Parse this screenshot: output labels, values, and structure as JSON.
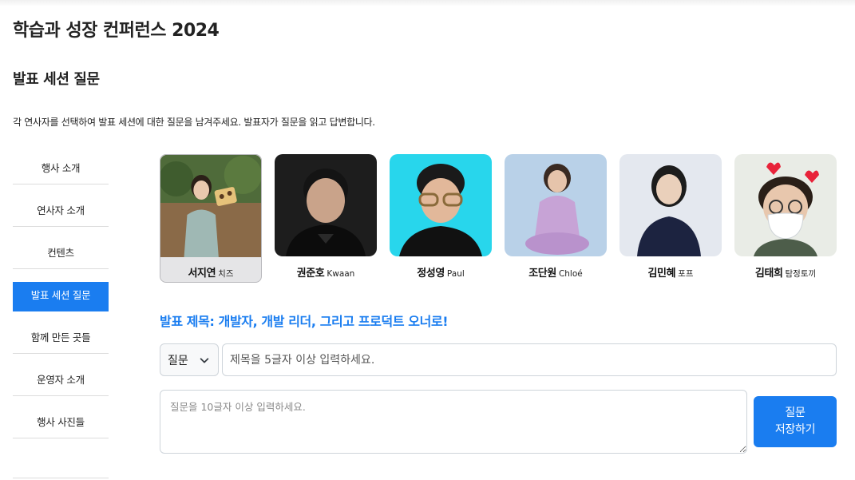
{
  "site": {
    "title": "학습과 성장 컨퍼런스 2024"
  },
  "page": {
    "heading": "발표 세션 질문",
    "intro": "각 연사자를 선택하여 발표 세션에 대한 질문을 남겨주세요. 발표자가 질문을 읽고 답변합니다."
  },
  "sidebar": {
    "items": [
      {
        "label": "행사 소개",
        "active": false
      },
      {
        "label": "연사자 소개",
        "active": false
      },
      {
        "label": "컨텐츠",
        "active": false
      },
      {
        "label": "발표 세션 질문",
        "active": true
      },
      {
        "label": "함께 만든 곳들",
        "active": false
      },
      {
        "label": "운영자 소개",
        "active": false
      },
      {
        "label": "행사 사진들",
        "active": false
      }
    ]
  },
  "speakers": [
    {
      "name": "서지연",
      "nickname": "치즈",
      "selected": true
    },
    {
      "name": "권준호",
      "nickname": "Kwaan",
      "selected": false
    },
    {
      "name": "정성영",
      "nickname": "Paul",
      "selected": false
    },
    {
      "name": "조단원",
      "nickname": "Chloé",
      "selected": false
    },
    {
      "name": "김민혜",
      "nickname": "포프",
      "selected": false
    },
    {
      "name": "김태희",
      "nickname": "탐정토끼",
      "selected": false
    }
  ],
  "session": {
    "title": "발표 제목: 개발자, 개발 리더, 그리고 프로덕트 오너로!"
  },
  "form": {
    "type_select": {
      "value": "질문",
      "icon": "chevron-down-icon"
    },
    "title_input": {
      "placeholder": "제목을 5글자 이상 입력하세요.",
      "value": ""
    },
    "question_input": {
      "placeholder": "질문을 10글자 이상 입력하세요.",
      "value": ""
    },
    "save_button": {
      "line1": "질문",
      "line2": "저장하기"
    }
  },
  "colors": {
    "accent": "#1a7df0",
    "selected_card": "#e5e5e7",
    "border": "#ced4da"
  }
}
